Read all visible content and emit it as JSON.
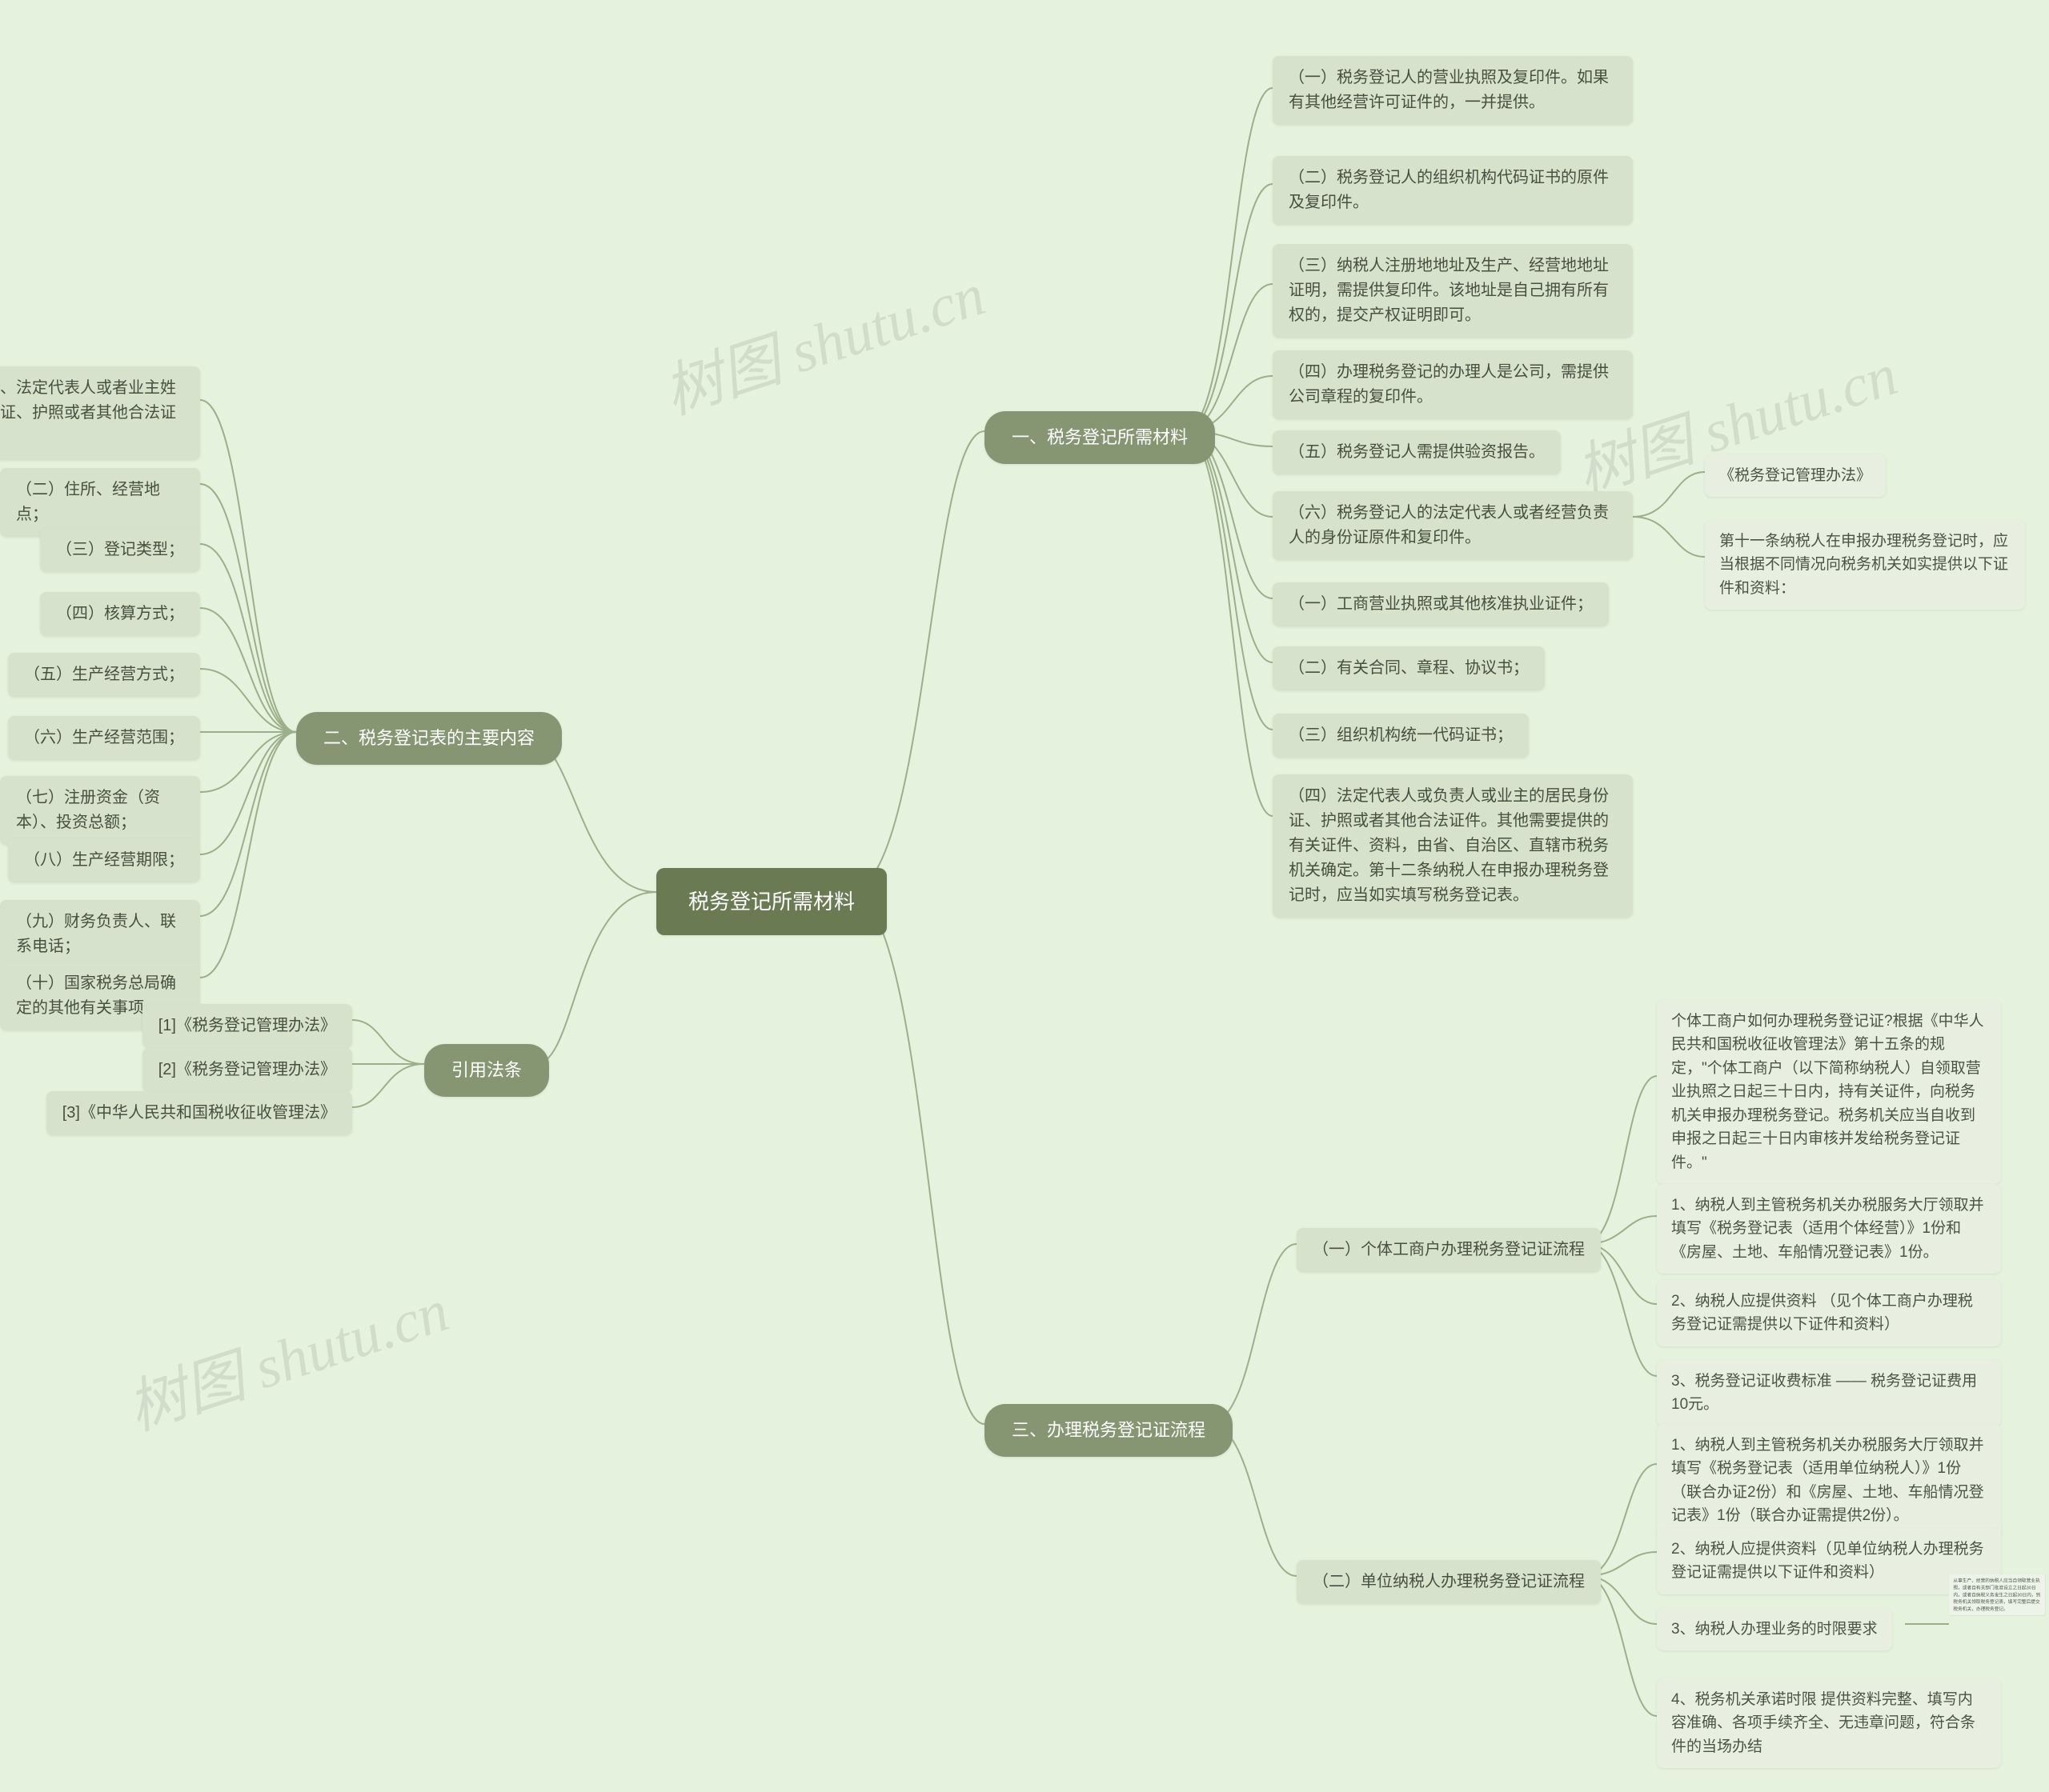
{
  "watermark_text": "树图 shutu.cn",
  "root": {
    "title": "税务登记所需材料"
  },
  "branch1": {
    "title": "一、税务登记所需材料",
    "items": [
      "（一）税务登记人的营业执照及复印件。如果有其他经营许可证件的，一并提供。",
      "（二）税务登记人的组织机构代码证书的原件及复印件。",
      "（三）纳税人注册地地址及生产、经营地地址证明，需提供复印件。该地址是自己拥有所有权的，提交产权证明即可。",
      "（四）办理税务登记的办理人是公司，需提供公司章程的复印件。",
      "（五）税务登记人需提供验资报告。",
      "（六）税务登记人的法定代表人或者经营负责人的身份证原件和复印件。",
      "（一）工商营业执照或其他核准执业证件；",
      "（二）有关合同、章程、协议书；",
      "（三）组织机构统一代码证书；",
      "（四）法定代表人或负责人或业主的居民身份证、护照或者其他合法证件。其他需要提供的有关证件、资料，由省、自治区、直辖市税务机关确定。第十二条纳税人在申报办理税务登记时，应当如实填写税务登记表。"
    ],
    "ref": {
      "a": "《税务登记管理办法》",
      "b": "第十一条纳税人在申报办理税务登记时，应当根据不同情况向税务机关如实提供以下证件和资料："
    }
  },
  "branch2": {
    "title": "二、税务登记表的主要内容",
    "items": [
      "（一）单位名称、法定代表人或者业主姓名及其居民身份证、护照或者其他合法证件的号码；",
      "（二）住所、经营地点；",
      "（三）登记类型；",
      "（四）核算方式；",
      "（五）生产经营方式；",
      "（六）生产经营范围；",
      "（七）注册资金（资本）、投资总额；",
      "（八）生产经营期限；",
      "（九）财务负责人、联系电话；",
      "（十）国家税务总局确定的其他有关事项。"
    ]
  },
  "branch3": {
    "title": "三、办理税务登记证流程",
    "sub1": {
      "title": "（一）个体工商户办理税务登记证流程",
      "items": [
        "个体工商户如何办理税务登记证?根据《中华人民共和国税收征收管理法》第十五条的规定，\"个体工商户（以下简称纳税人）自领取营业执照之日起三十日内，持有关证件，向税务机关申报办理税务登记。税务机关应当自收到申报之日起三十日内审核并发给税务登记证件。\"",
        "1、纳税人到主管税务机关办税服务大厅领取并填写《税务登记表（适用个体经营）》1份和《房屋、土地、车船情况登记表》1份。",
        "2、纳税人应提供资料 （见个体工商户办理税务登记证需提供以下证件和资料）",
        "3、税务登记证收费标准 —— 税务登记证费用10元。"
      ]
    },
    "sub2": {
      "title": "（二）单位纳税人办理税务登记证流程",
      "items": [
        "1、纳税人到主管税务机关办税服务大厅领取并填写《税务登记表（适用单位纳税人）》1份（联合办证2份）和《房屋、土地、车船情况登记表》1份（联合办证需提供2份）。",
        "2、纳税人应提供资料（见单位纳税人办理税务登记证需提供以下证件和资料）",
        "3、纳税人办理业务的时限要求",
        "4、税务机关承诺时限 提供资料完整、填写内容准确、各项手续齐全、无违章问题，符合条件的当场办结"
      ],
      "item3_detail": "从事生产、经营的纳税人应当自领取营业执照，或者自有关部门批准设立之日起30日内，或者自纳税义务发生之日起30日内，到税务机关领取税务登记表，填写完整后提交税务机关，办理税务登记。"
    }
  },
  "branch4": {
    "title": "引用法条",
    "items": [
      "[1]《税务登记管理办法》",
      "[2]《税务登记管理办法》",
      "[3]《中华人民共和国税收征收管理法》"
    ]
  }
}
